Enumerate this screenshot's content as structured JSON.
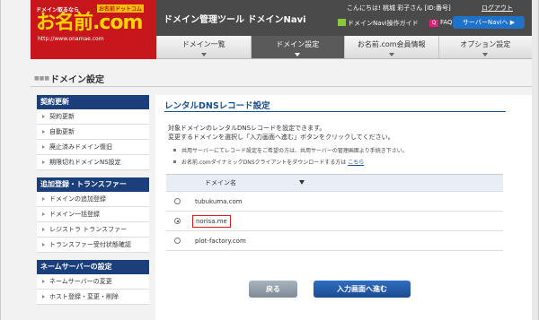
{
  "header": {
    "logo_tagline": "ドメイン取るなら",
    "logo_badge": "お名前ドットコム",
    "logo_brand": "お名前.com",
    "logo_url": "http://www.onamae.com",
    "tool_name": "ドメイン管理ツール ドメインNavi",
    "greeting": "こんにちは! 桃城 彩子さん [ID:番号]",
    "logout": "ログアウト",
    "guide": "ドメインNavi操作ガイド",
    "faq": "FAQ",
    "faq_icon_text": "Q",
    "service_nav": "サーバーNaviへ ▶"
  },
  "nav": {
    "tabs": [
      {
        "label": "ドメイン一覧",
        "active": false
      },
      {
        "label": "ドメイン設定",
        "active": true
      },
      {
        "label": "お名前.com会員情報",
        "active": false
      },
      {
        "label": "オプション設定",
        "active": false
      }
    ]
  },
  "page_title": {
    "deco": "■■■",
    "title": "ドメイン設定"
  },
  "sidebar": {
    "sections": [
      {
        "heading": "契約更新",
        "items": [
          "契約更新",
          "自動更新",
          "廃止済みドメイン復旧",
          "期限切れドメインNS設定"
        ]
      },
      {
        "heading": "追加登録・トランスファー",
        "items": [
          "ドメインの追加登録",
          "ドメイン一括登録",
          "レジストラ トランスファー",
          "トランスファー受付状態確認"
        ]
      },
      {
        "heading": "ネームサーバーの設定",
        "items": [
          "ネームサーバーの変更",
          "ホスト登録・変更・削除"
        ]
      }
    ]
  },
  "main": {
    "section_title": "レンタルDNSレコード設定",
    "desc_line1": "対象ドメインのレンタルDNSレコードを設定できます。",
    "desc_line2": "変更するドメインを選択し「入力画面へ進む」ボタンをクリックしてください。",
    "note1": "共用サーバーにてレコード設定をご希望の方は、共用サーバーの管理画面より手続き下さい。",
    "note2_text": "お名前.comダイナミックDNSクライアントをダウンロードする方は",
    "note2_link": "こちら",
    "table": {
      "header": "ドメイン名",
      "rows": [
        {
          "domain": "tubukuma.com",
          "selected": false
        },
        {
          "domain": "norisa.me",
          "selected": true
        },
        {
          "domain": "plot-factory.com",
          "selected": false
        }
      ]
    },
    "back_button": "戻る",
    "next_button": "入力画面へ進む"
  },
  "colors": {
    "brand_red": "#c8161d",
    "brand_yellow": "#ffd400",
    "sidebar_heading": "#1a3f7a",
    "accent_blue": "#1b4a8f",
    "selection_border": "#d81e1e"
  }
}
